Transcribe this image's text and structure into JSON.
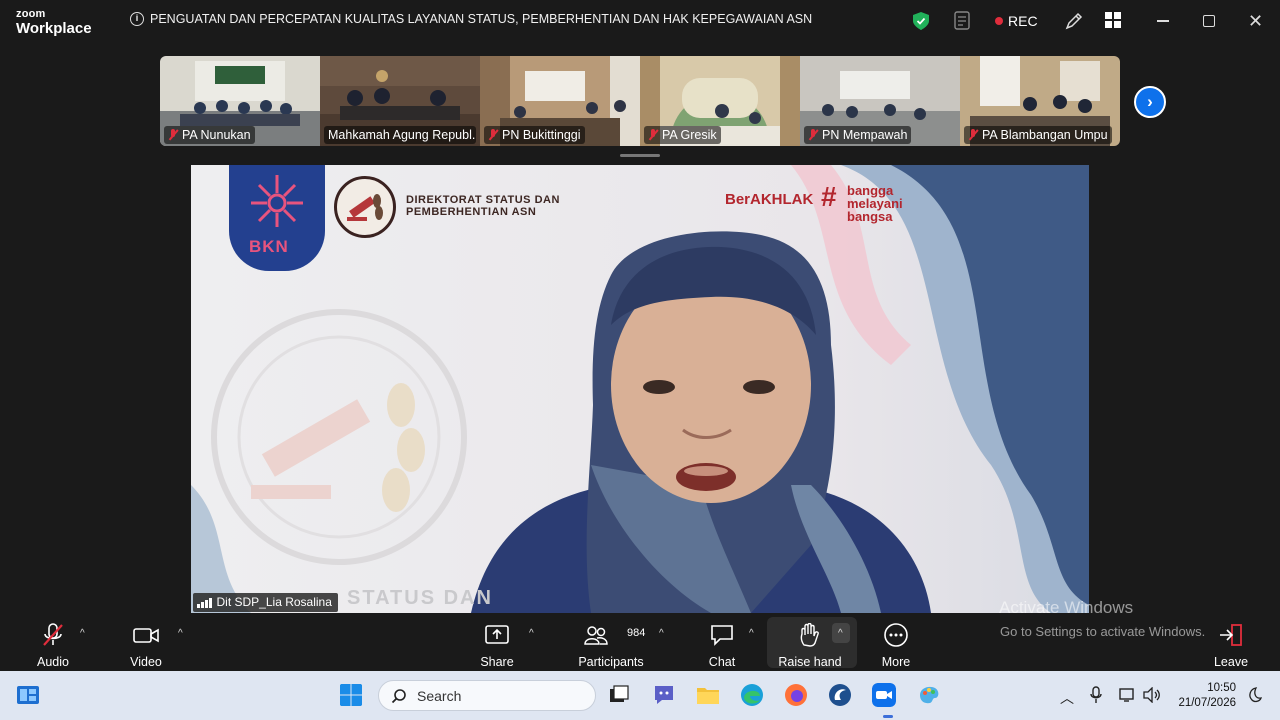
{
  "app": {
    "brand_top": "zoom",
    "brand_bottom": "Workplace"
  },
  "meeting": {
    "title": "PENGUATAN DAN PERCEPATAN KUALITAS LAYANAN STATUS, PEMBERHENTIAN DAN HAK KEPEGAWAIAN ASN",
    "rec_label": "REC"
  },
  "participants_strip": [
    {
      "name": "PA Nunukan",
      "muted": true
    },
    {
      "name": "Mahkamah Agung Republ...",
      "muted": false
    },
    {
      "name": "PN Bukittinggi",
      "muted": true
    },
    {
      "name": "PA Gresik",
      "muted": true
    },
    {
      "name": "PN Mempawah",
      "muted": true
    },
    {
      "name": "PA Blambangan Umpu",
      "muted": true
    }
  ],
  "main_video": {
    "speaker": "Dit SDP_Lia Rosalina",
    "bkn_text": "BKN",
    "dir_line1": "DIREKTORAT STATUS DAN",
    "dir_line2": "PEMBERHENTIAN ASN",
    "berakhlak": "BerAKHLAK",
    "bangga_1": "bangga",
    "bangga_2": "melayani",
    "bangga_3": "bangsa",
    "watermark": "STATUS DAN"
  },
  "toolbar": {
    "audio": "Audio",
    "video": "Video",
    "share": "Share",
    "participants": "Participants",
    "participant_count": "984",
    "chat": "Chat",
    "raise_hand": "Raise hand",
    "more": "More",
    "leave": "Leave"
  },
  "watermark_windows": {
    "line1": "Activate Windows",
    "line2": "Go to Settings to activate Windows."
  },
  "taskbar": {
    "search_placeholder": "Search",
    "time": "10:50",
    "date": "21/07/2026"
  },
  "colors": {
    "zoom_blue": "#0e71eb",
    "rec_red": "#e02d3c",
    "background": "#1a1a1a"
  }
}
